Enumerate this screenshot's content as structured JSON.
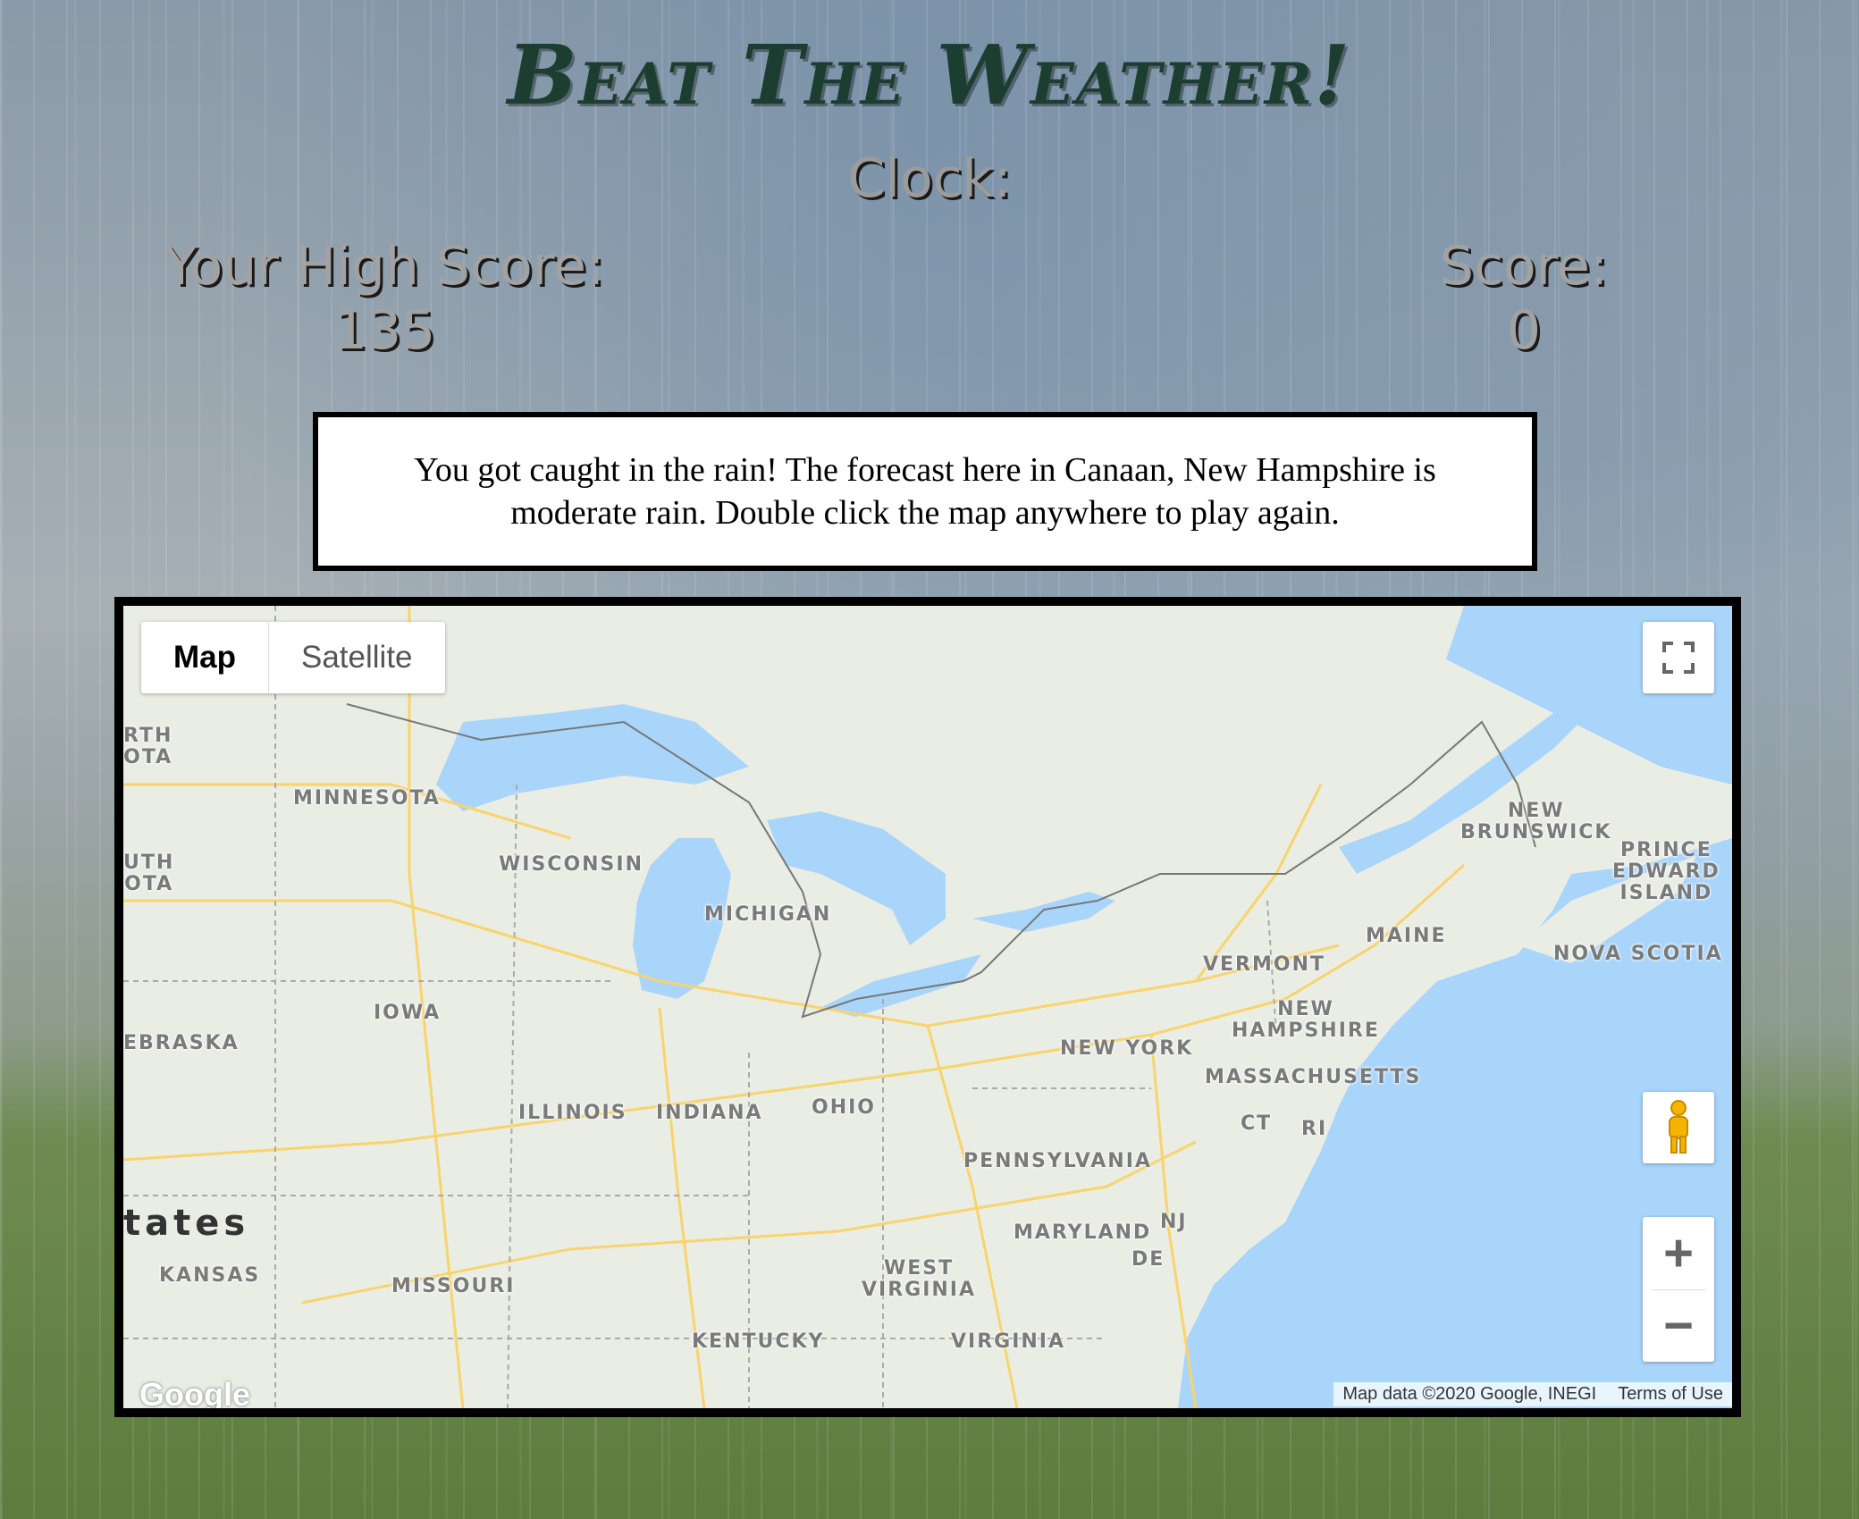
{
  "title": "Beat The Weather!",
  "clock": {
    "label": "Clock:"
  },
  "high_score": {
    "label": "Your High Score:",
    "value": "135"
  },
  "score": {
    "label": "Score:",
    "value": "0"
  },
  "message": "You got caught in the rain! The forecast here in Canaan, New Hampshire is moderate rain. Double click the map anywhere to play again.",
  "map": {
    "map_type": {
      "map_label": "Map",
      "satellite_label": "Satellite",
      "selected": "Map"
    },
    "zoom_in": "+",
    "zoom_out": "−",
    "country_label": "tates",
    "labels": {
      "north_dakota": "RTH\nOTA",
      "south_dakota": "UTH\nOTA",
      "minnesota": "MINNESOTA",
      "wisconsin": "WISCONSIN",
      "michigan": "MICHIGAN",
      "iowa": "IOWA",
      "nebraska": "EBRASKA",
      "illinois": "ILLINOIS",
      "indiana": "INDIANA",
      "ohio": "OHIO",
      "kansas": "KANSAS",
      "missouri": "MISSOURI",
      "kentucky": "KENTUCKY",
      "west_virginia": "WEST\nVIRGINIA",
      "virginia": "VIRGINIA",
      "maryland": "MARYLAND",
      "de": "DE",
      "nj": "NJ",
      "pennsylvania": "PENNSYLVANIA",
      "new_york": "NEW YORK",
      "ct": "CT",
      "ri": "RI",
      "massachusetts": "MASSACHUSETTS",
      "new_hampshire": "NEW\nHAMPSHIRE",
      "vermont": "VERMONT",
      "maine": "MAINE",
      "new_brunswick": "NEW\nBRUNSWICK",
      "prince_edward_island": "PRINCE\nEDWARD\nISLAND",
      "nova_scotia": "NOVA SCOTIA"
    },
    "logo": "Google",
    "attribution": "Map data ©2020 Google, INEGI",
    "terms": "Terms of Use",
    "colors": {
      "water": "#a9d5fb",
      "land": "#e9ede4",
      "roads": "#f9d36b"
    }
  }
}
